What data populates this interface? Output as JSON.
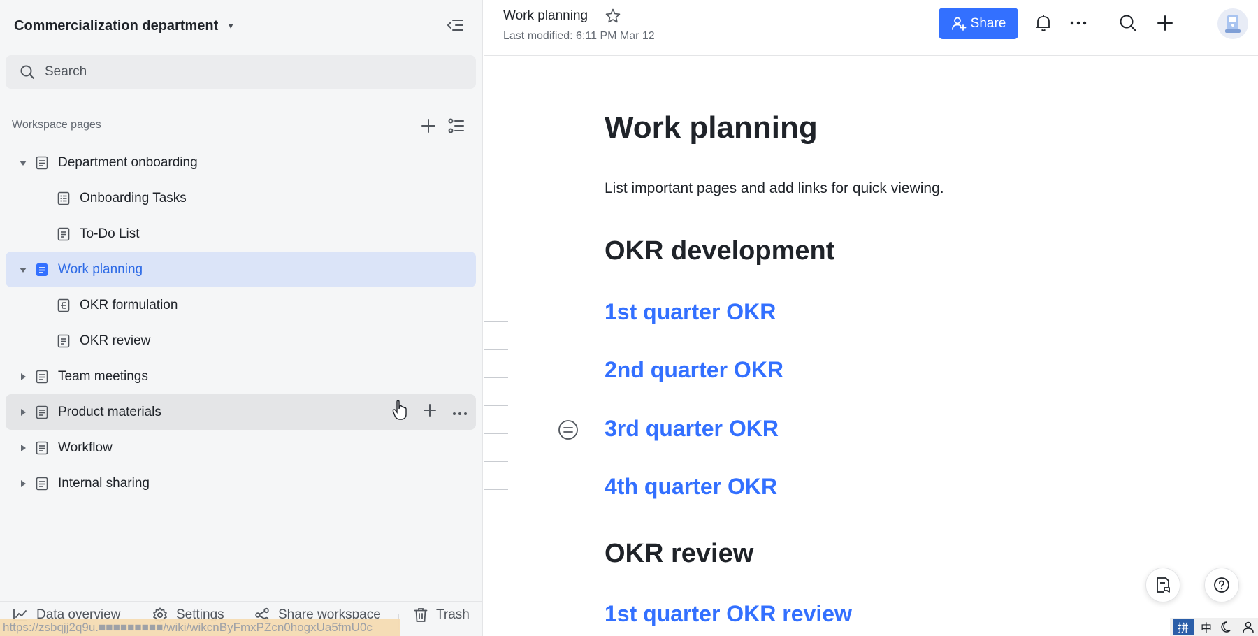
{
  "sidebar": {
    "workspace_name": "Commercialization department",
    "search_placeholder": "Search",
    "section_label": "Workspace pages",
    "items": [
      {
        "label": "Department onboarding"
      },
      {
        "label": "Onboarding Tasks"
      },
      {
        "label": "To-Do List"
      },
      {
        "label": "Work planning"
      },
      {
        "label": "OKR formulation"
      },
      {
        "label": "OKR review"
      },
      {
        "label": "Team meetings"
      },
      {
        "label": "Product materials"
      },
      {
        "label": "Workflow"
      },
      {
        "label": "Internal sharing"
      }
    ],
    "footer": {
      "data_overview": "Data overview",
      "settings": "Settings",
      "share_workspace": "Share workspace",
      "trash": "Trash"
    },
    "status_url": "https://zsbqjj2q9u.■■■■■■■■■/wiki/wikcnByFmxPZcn0hogxUa5fmU0c"
  },
  "header": {
    "doc_title": "Work planning",
    "last_modified": "Last modified: 6:11 PM Mar 12",
    "share_label": "Share"
  },
  "document": {
    "title": "Work planning",
    "description": "List important pages and add links for quick viewing.",
    "sections": [
      {
        "heading": "OKR development",
        "links": [
          "1st quarter OKR",
          "2nd quarter OKR",
          "3rd quarter OKR",
          "4th quarter OKR"
        ]
      },
      {
        "heading": "OKR review",
        "links": [
          "1st quarter OKR review"
        ]
      }
    ]
  },
  "tray": {
    "ime_label": "拼",
    "lang_label": "中"
  },
  "colors": {
    "accent": "#3370ff",
    "selected_bg": "#dbe4f8",
    "sidebar_bg": "#f5f6f7",
    "text": "#1f2329"
  }
}
